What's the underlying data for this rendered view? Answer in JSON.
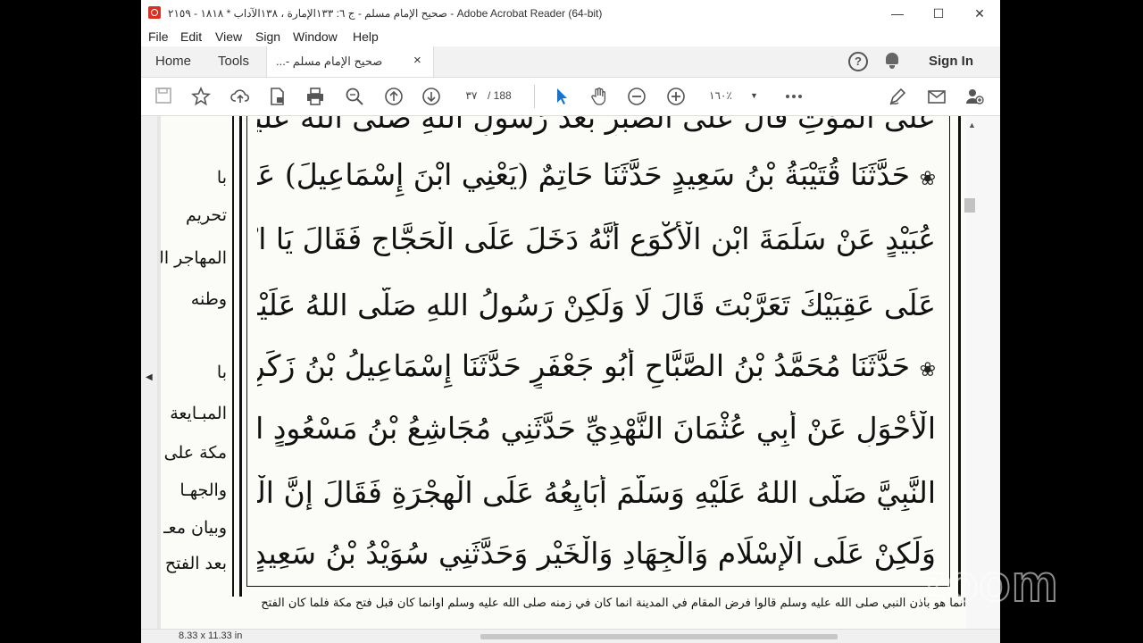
{
  "window": {
    "title": "صحيح الإمام مسلم - ج ٦: ١٣٣الإمارة ، ١٣٨الآداب * ١٨١٨ - ٢١٥٩ - Adobe Acrobat Reader (64-bit)",
    "minimize": "—",
    "maximize": "☐",
    "close": "✕"
  },
  "menu": [
    "File",
    "Edit",
    "View",
    "Sign",
    "Window",
    "Help"
  ],
  "tabs": {
    "home": "Home",
    "tools": "Tools",
    "document": "صحيح الإمام مسلم -...",
    "close": "×"
  },
  "header_right": {
    "help": "?",
    "sign_in": "Sign In"
  },
  "toolbar": {
    "current_page": "٣٧",
    "total_pages": "/  188",
    "zoom": "١٦٠٪"
  },
  "margin_lines": [
    "با",
    "تحريم",
    "المهاجر الى",
    "وطنه",
    "با",
    "المبـايعة",
    "مكة على",
    "والجهـا",
    "وبيان معـ",
    "بعد الفتح"
  ],
  "text_lines": [
    "عَلَى الْمَوْتِ قَالَ عَلَى الصَّبْرِ بَعْدَ رَسُولِ اللهِ صَلَّى اللهُ عَلَيْهِ وَسَلَّمَ",
    "حَدَّثَنَا قُتَيْبَةُ بْنُ سَعِيدٍ حَدَّثَنَا حَاتِمٌ (يَعْنِي ابْنَ إِسْمَاعِيلَ) عَنْ يَزِيدَ بْنِ أَبِي",
    "عُبَيْدٍ عَنْ سَلَمَةَ ابْنِ الْأَكْوَعِ أَنَّهُ دَخَلَ عَلَى الْحَجَّاجِ فَقَالَ يَا ابْنَ الْأَكْوَعِ ارْتَدَدْتَ",
    "عَلَى عَقِبَيْكَ تَعَرَّبْتَ قَالَ لَا وَلَكِنْ رَسُولُ اللهِ صَلَّى اللهُ عَلَيْهِ وَسَلَّمَ أَذِنَ لِي فِي الْبَدْوِ",
    "حَدَّثَنَا مُحَمَّدُ بْنُ الصَّبَّاحِ أَبُو جَعْفَرٍ حَدَّثَنَا إِسْمَاعِيلُ بْنُ زَكَرِيَّاءَ عَنْ عَاصِمٍ",
    "الْأَحْوَلِ عَنْ أَبِي عُثْمَانَ النَّهْدِيِّ حَدَّثَنِي مُجَاشِعُ بْنُ مَسْعُودٍ السُّلَمِيُّ قَالَ أَتَيْتُ",
    "النَّبِيَّ صَلَّى اللهُ عَلَيْهِ وَسَلَّمَ أُبَايِعُهُ عَلَى الْهِجْرَةِ فَقَالَ إِنَّ الْهِجْرَةَ قَدْ مَضَتْ لِأَهْلِهَا",
    "وَلَكِنْ عَلَى الْإِسْلَامِ وَالْجِهَادِ وَالْخَيْرِ وَحَدَّثَنِي سُوَيْدُ بْنُ سَعِيدٍ حَدَّثَنَا عَلِيُّ بْنُ"
  ],
  "footnote": "انما هو باذن النبي صلى الله عليه وسلم قالوا فرض المقام في المدينة انما كان في زمنه صلى الله عليه وسلم اوانما كان قبل فتح مكة فلما كان الفتح",
  "status": {
    "page_size": "8.33 x 11.33 in"
  },
  "overlay": {
    "watermark": "zoom"
  }
}
